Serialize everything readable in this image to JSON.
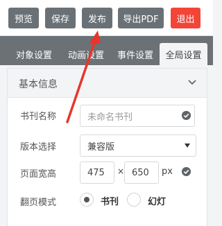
{
  "toolbar": {
    "preview_label": "预览",
    "save_label": "保存",
    "publish_label": "发布",
    "export_label": "导出PDF",
    "exit_label": "退出"
  },
  "tabs": [
    {
      "label": "对象设置",
      "active": false
    },
    {
      "label": "动画设置",
      "active": false
    },
    {
      "label": "事件设置",
      "active": false
    },
    {
      "label": "全局设置",
      "active": true
    }
  ],
  "panel": {
    "title": "基本信息",
    "name": {
      "label": "书刊名称",
      "placeholder": "未命名书刊"
    },
    "version": {
      "label": "版本选择",
      "selected": "兼容版"
    },
    "size": {
      "label": "页面宽高",
      "width": "475",
      "times": "×",
      "height": "650",
      "unit": "px"
    },
    "flip": {
      "label": "翻页模式",
      "options": [
        {
          "label": "书刊",
          "checked": true
        },
        {
          "label": "幻灯",
          "checked": false
        }
      ]
    }
  },
  "colors": {
    "button_gray": "#6a7176",
    "button_danger": "#f24538",
    "tab_bar": "#6c7175",
    "annotation_red": "#e8352a"
  },
  "icons": [
    "chevron-down-icon",
    "check-circle-icon",
    "select-arrow-icon",
    "annotation-arrow"
  ]
}
